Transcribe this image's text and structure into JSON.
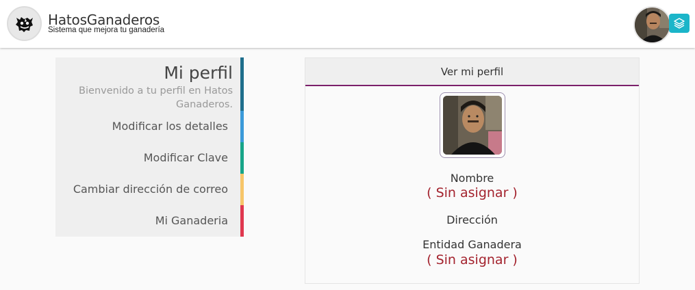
{
  "header": {
    "brand_title": "HatosGanaderos",
    "brand_subtitle": "Sistema que mejora tu ganadería",
    "logo_icon": "cow-icon",
    "user_avatar_icon": "user-avatar-photo",
    "layers_icon": "layers-icon",
    "accent_color": "#1bb5c9"
  },
  "side_menu": {
    "title": "Mi perfil",
    "welcome": "Bienvenido a tu perfil en Hatos Ganaderos.",
    "items": [
      {
        "label": "Modificar los detalles",
        "color": "#3b9ad9"
      },
      {
        "label": "Modificar Clave",
        "color": "#17a589"
      },
      {
        "label": "Cambiar dirección de correo",
        "color": "#f7c66a"
      },
      {
        "label": "Mi Ganaderia",
        "color": "#e0384f"
      }
    ],
    "head_color": "#1e6e8c"
  },
  "profile": {
    "panel_title": "Ver mi perfil",
    "panel_accent": "#7b1f6a",
    "fields": [
      {
        "label": "Nombre",
        "value": "( Sin asignar )"
      },
      {
        "label": "Dirección",
        "value": ""
      },
      {
        "label": "Entidad Ganadera",
        "value": "( Sin asignar )"
      }
    ],
    "value_color": "#a3222d"
  }
}
